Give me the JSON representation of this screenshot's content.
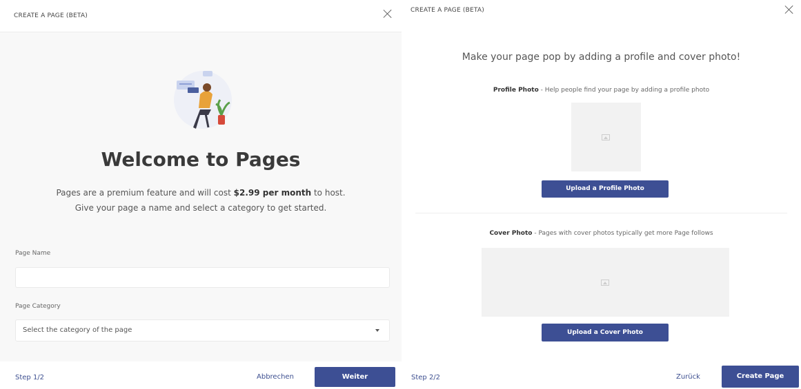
{
  "left": {
    "header_title": "CREATE A PAGE (BETA)",
    "welcome_title": "Welcome to Pages",
    "desc_part1": "Pages are a premium feature and will cost ",
    "desc_bold": "$2.99 per month",
    "desc_part2": " to host.",
    "desc_line2": "Give your page a name and select a category to get started.",
    "page_name_label": "Page Name",
    "page_name_value": "",
    "page_category_label": "Page Category",
    "category_selected": "Select the category of the page",
    "step": "Step 1/2",
    "cancel_label": "Abbrechen",
    "next_label": "Weiter"
  },
  "right": {
    "header_title": "CREATE A PAGE (BETA)",
    "headline": "Make your page pop by adding a profile and cover photo!",
    "profile_label_bold": "Profile Photo",
    "profile_label_rest": " - Help people find your page by adding a profile photo",
    "upload_profile_label": "Upload a Profile Photo",
    "cover_label_bold": "Cover Photo",
    "cover_label_rest": " - Pages with cover photos typically get more Page follows",
    "upload_cover_label": "Upload a Cover Photo",
    "step": "Step 2/2",
    "back_label": "Zurück",
    "create_label": "Create Page"
  },
  "colors": {
    "primary": "#3d4f94",
    "link": "#3c4e8f",
    "placeholder": "#f2f2f2"
  }
}
